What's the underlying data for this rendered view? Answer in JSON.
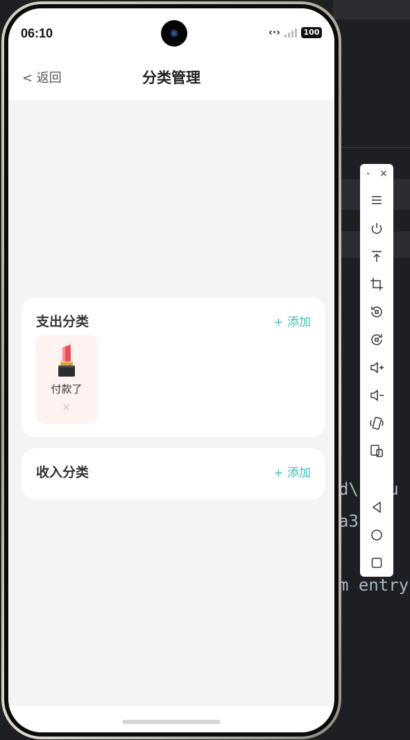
{
  "status_bar": {
    "time": "06:10",
    "battery": "100"
  },
  "nav": {
    "back_label": "< 返回",
    "title": "分类管理"
  },
  "expense": {
    "title": "支出分类",
    "add_label": "+ 添加",
    "items": [
      {
        "name": "付款了",
        "icon": "lipstick-icon",
        "delete": "×"
      }
    ]
  },
  "income": {
    "title": "收入分类",
    "add_label": "+ 添加",
    "items": []
  },
  "code_lines": [
    "d\\ fau",
    "a3  a",
    "m entry"
  ],
  "emulator_toolbar": {
    "minimize": "-",
    "close": "×",
    "buttons": [
      "menu-icon",
      "power-icon",
      "pin-top-icon",
      "crop-icon",
      "rotate-left-icon",
      "rotate-right-icon",
      "volume-up-icon",
      "volume-down-icon",
      "shake-icon",
      "multi-device-icon",
      "back-icon",
      "home-icon",
      "recents-icon"
    ]
  },
  "colors": {
    "accent": "#3fbfb3",
    "item_bg": "#fff3f2",
    "screen_bg": "#f4f4f4"
  }
}
